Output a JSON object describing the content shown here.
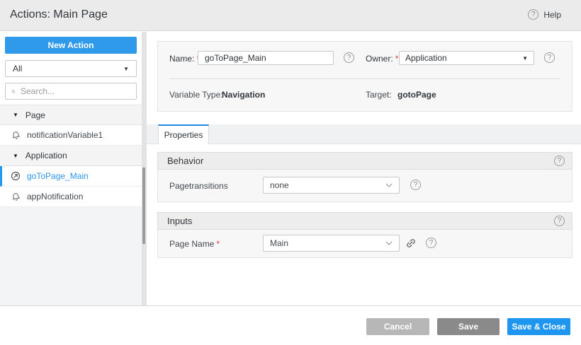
{
  "ui": {
    "required_marker": "*",
    "question_glyph": "?",
    "caret_glyph": "▼"
  },
  "header": {
    "title": "Actions: Main Page",
    "help_label": "Help"
  },
  "sidebar": {
    "new_action_label": "New Action",
    "filter_value": "All",
    "search_placeholder": "Search...",
    "tree": {
      "group1": "Page",
      "item1": "notificationVariable1",
      "group2": "Application",
      "item2": "goToPage_Main",
      "item3": "appNotification"
    }
  },
  "form": {
    "name_label": "Name:",
    "name_value": "goToPage_Main",
    "owner_label": "Owner:",
    "owner_value": "Application",
    "variable_type_label": "Variable Type:",
    "variable_type_value": "Navigation",
    "target_label": "Target:",
    "target_value": "gotoPage"
  },
  "tabs": {
    "properties": "Properties"
  },
  "behavior": {
    "title": "Behavior",
    "pagetransitions_label": "Pagetransitions",
    "pagetransitions_value": "none"
  },
  "inputs": {
    "title": "Inputs",
    "page_name_label": "Page Name",
    "page_name_value": "Main"
  },
  "footer": {
    "cancel": "Cancel",
    "save": "Save",
    "save_close": "Save & Close"
  },
  "colors": {
    "accent_blue": "#2e9ae9",
    "save_close_blue": "#1e96f0",
    "selected_item_blue": "#2b96ec",
    "required_red": "#e5393c",
    "cancel_gray": "#b7b7b7",
    "save_gray": "#8a8a8a"
  }
}
